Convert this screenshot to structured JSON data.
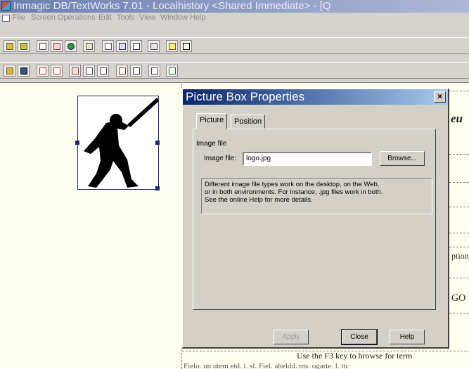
{
  "window": {
    "title": "Inmagic DB/TextWorks 7.01 - Localhistory <Shared Immediate> - [Q"
  },
  "menu": {
    "items": [
      "File",
      "Screen Operations",
      "Edit",
      "Tools",
      "View",
      "Window",
      "Help"
    ]
  },
  "background_form": {
    "fragments": [
      "eu",
      "ption",
      "GO"
    ],
    "hint_text": "Use the F3 key to browse for term",
    "bottom_text": "Fielo. un utem etd. l. sl. Fiel. aheldd. ms. ogarte. l. ttc"
  },
  "dialog": {
    "title": "Picture Box Properties",
    "close_label": "×",
    "tabs": [
      {
        "label": "Picture",
        "active": true
      },
      {
        "label": "Position",
        "active": false
      }
    ],
    "group_label": "Image file",
    "image_file_label": "Image file:",
    "image_file_value": "logo.jpg",
    "browse_label": "Browse...",
    "info_lines": [
      "Different image file types work on the desktop, on the Web,",
      "or in both environments. For instance, .jpg files work in both.",
      "See the online Help for more details."
    ],
    "buttons": {
      "apply": "Apply",
      "close": "Close",
      "help": "Help"
    }
  },
  "colors": {
    "title_bar": "#6b7fae",
    "dialog_title": "#0a246a",
    "workspace": "#fffff0"
  }
}
